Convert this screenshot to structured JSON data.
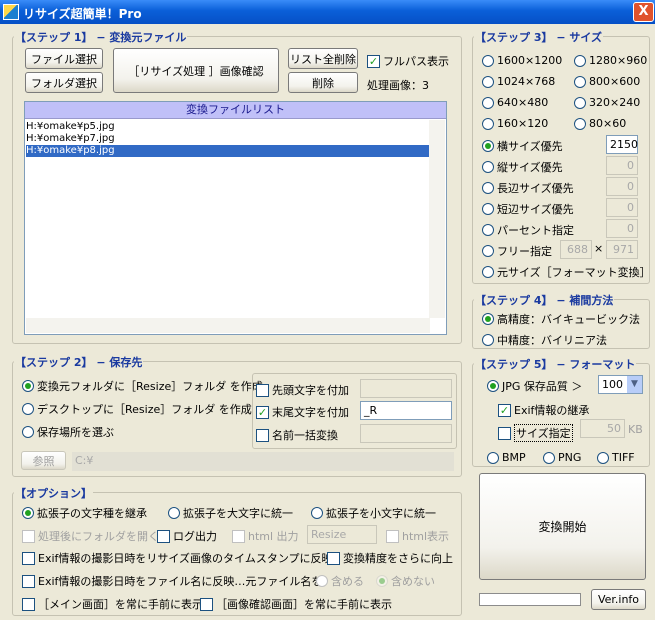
{
  "window": {
    "title": "リサイズ超簡単！Pro",
    "close": "X"
  },
  "step1": {
    "title": "【ステップ 1】 − 変換元ファイル",
    "file_select": "ファイル選択",
    "folder_select": "フォルダ選択",
    "preview": "［リサイズ処理 ］画像確認",
    "clear_all": "リスト全削除",
    "delete": "削除",
    "fullpath": "フルパス表示",
    "count_label": "処理画像：3",
    "list_header": "変換ファイルリスト",
    "files": [
      "H:¥omake¥p5.jpg",
      "H:¥omake¥p7.jpg",
      "H:¥omake¥p8.jpg"
    ]
  },
  "step2": {
    "title": "【ステップ 2】 − 保存先",
    "opt1": "変換元フォルダに［Resize］フォルダ を作成",
    "opt2": "デスクトップに［Resize］フォルダ を作成",
    "opt3": "保存場所を選ぶ",
    "prefix": "先頭文字を付加",
    "suffix": "末尾文字を付加",
    "suffix_value": "_R",
    "rename": "名前一括変換",
    "browse": "参照",
    "path": "C:¥"
  },
  "options": {
    "title": "【オプション】",
    "ext_keep": "拡張子の文字種を継承",
    "ext_upper": "拡張子を大文字に統一",
    "ext_lower": "拡張子を小文字に統一",
    "open_folder": "処理後にフォルダを開く",
    "log": "ログ出力",
    "html": "html 出力",
    "html_value": "Resize",
    "html_show": "html表示",
    "exif_time": "Exif情報の撮影日時をリサイズ画像のタイムスタンプに反映",
    "precision": "変換精度をさらに向上",
    "exif_name": "Exif情報の撮影日時をファイル名に反映…元ファイル名を",
    "include": "含める",
    "exclude": "含めない",
    "main_top": "［メイン画面］を常に手前に表示",
    "check_top": "［画像確認画面］を常に手前に表示"
  },
  "step3": {
    "title": "【ステップ 3】 − サイズ",
    "s1": "1600×1200",
    "s2": "1280×960",
    "s3": "1024×768",
    "s4": "800×600",
    "s5": "640×480",
    "s6": "320×240",
    "s7": "160×120",
    "s8": "80×60",
    "width": "横サイズ優先",
    "width_value": "2150",
    "height": "縦サイズ優先",
    "height_value": "0",
    "long": "長辺サイズ優先",
    "long_value": "0",
    "short": "短辺サイズ優先",
    "short_value": "0",
    "percent": "パーセント指定",
    "percent_value": "0",
    "free": "フリー指定",
    "free_w": "688",
    "free_x": "×",
    "free_h": "971",
    "orig": "元サイズ［フォーマット変換］"
  },
  "step4": {
    "title": "【ステップ 4】 − 補間方法",
    "bicubic": "高精度：バイキュービック法",
    "bilinear": "中精度：バイリニア法"
  },
  "step5": {
    "title": "【ステップ 5】 − フォーマット",
    "jpg": "JPG  保存品質 ＞",
    "quality": "100",
    "exif": "Exif情報の継承",
    "size": "サイズ指定",
    "size_value": "50",
    "kb": "KB",
    "bmp": "BMP",
    "png": "PNG",
    "tiff": "TIFF"
  },
  "start": "変換開始",
  "ver": "Ver.info"
}
